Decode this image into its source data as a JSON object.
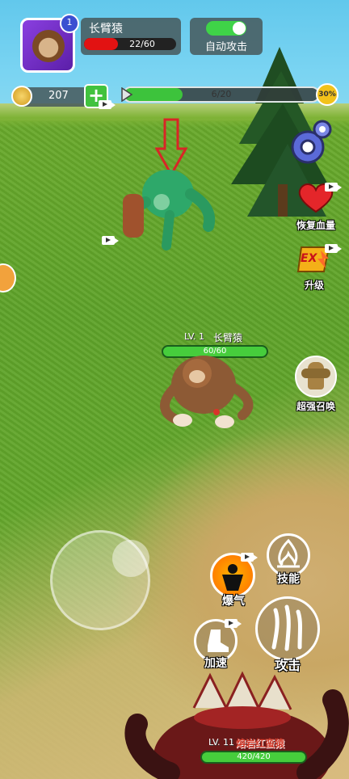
{
  "player": {
    "level_badge": "1",
    "name": "长臂猿",
    "hp_text": "22/60",
    "hp_fraction": 0.367
  },
  "auto_attack": {
    "label": "自动攻击",
    "enabled": true
  },
  "coins": {
    "value": "207"
  },
  "progress": {
    "text": "6/20",
    "fraction": 0.3,
    "reward_percent": "30%"
  },
  "side_buttons": {
    "restore_hp": "恢复血量",
    "upgrade": "升级",
    "upgrade_icon_text": "EX",
    "summon": "超强召唤"
  },
  "player_character": {
    "level": "LV. 1",
    "name": "长臂猿",
    "hp_text": "60/60"
  },
  "enemy_character": {
    "level": "LV. 11",
    "name": "熔岩红蛮猿",
    "hp_text": "420/420"
  },
  "skills": {
    "rage": "爆气",
    "skill": "技能",
    "speed": "加速",
    "attack": "攻击"
  },
  "colors": {
    "hp_red": "#e21212",
    "bar_green": "#46cd3c",
    "toggle_on": "#3fd348",
    "coin_gold": "#f2c21a"
  }
}
